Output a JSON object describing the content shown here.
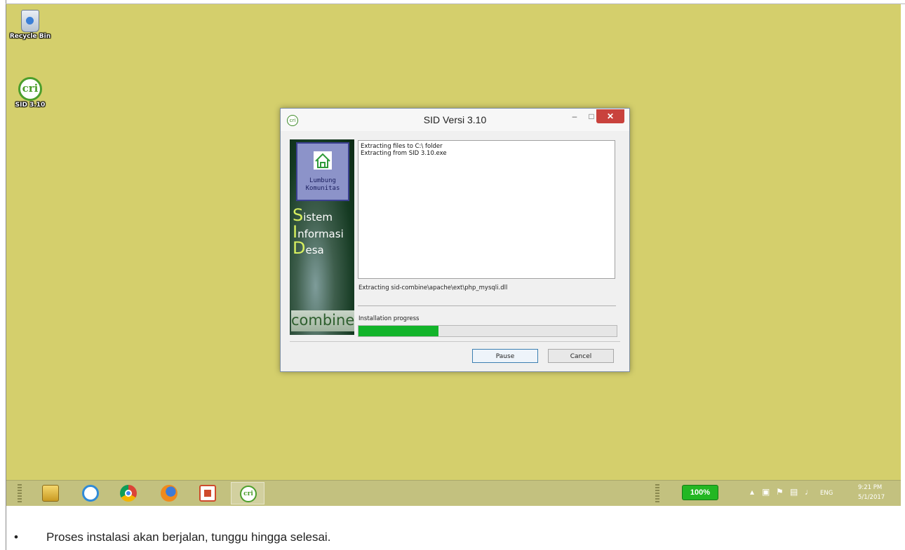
{
  "desktop": {
    "icons": [
      {
        "label": "Recycle Bin"
      },
      {
        "label": "SID 3.10"
      }
    ]
  },
  "dialog": {
    "title": "SID Versi 3.10",
    "side_panel": {
      "brand_line1": "Lumbung",
      "brand_line2": "Komunitas",
      "word1_cap": "S",
      "word1_rest": "istem",
      "word2_cap": "I",
      "word2_rest": "nformasi",
      "word3_cap": "D",
      "word3_rest": "esa",
      "footer_logo": "combine"
    },
    "log_lines": [
      "Extracting files to C:\\ folder",
      "Extracting from SID 3.10.exe"
    ],
    "status_text": "Extracting sid-combine\\apache\\ext\\php_mysqli.dll",
    "progress_label": "Installation progress",
    "progress_fraction": 0.31,
    "pause_label": "Pause",
    "cancel_label": "Cancel"
  },
  "taskbar": {
    "apps": [
      {
        "name": "File Explorer",
        "icon": "folder-icon"
      },
      {
        "name": "Internet Explorer",
        "icon": "ie-icon"
      },
      {
        "name": "Google Chrome",
        "icon": "chrome-icon"
      },
      {
        "name": "Firefox",
        "icon": "firefox-icon"
      },
      {
        "name": "PowerPoint",
        "icon": "powerpoint-icon"
      },
      {
        "name": "SID Installer",
        "icon": "cri-icon",
        "active": true
      }
    ],
    "battery": "100%",
    "language": "ENG",
    "time": "9:21 PM",
    "date": "5/1/2017"
  },
  "caption": {
    "bullet": "•",
    "text": "Proses instalasi akan berjalan, tunggu hingga selesai."
  },
  "colors": {
    "desktop_background": "#d4cf6c",
    "progress_fill": "#12b42a",
    "close_button": "#c9423d"
  }
}
